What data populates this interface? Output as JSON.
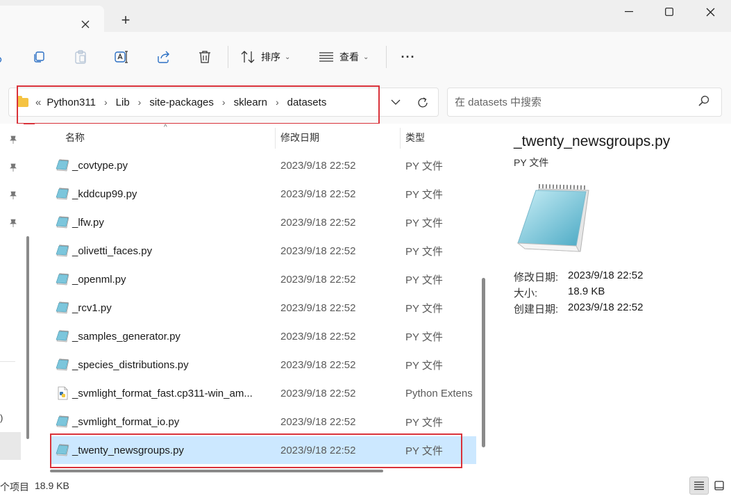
{
  "window": {
    "new_tab": "+"
  },
  "toolbar": {
    "sort_label": "排序",
    "view_label": "查看",
    "more_label": "···"
  },
  "address": {
    "overflow": "«",
    "crumbs": [
      "Python311",
      "Lib",
      "site-packages",
      "sklearn",
      "datasets"
    ],
    "separator": "›"
  },
  "search": {
    "placeholder": "在 datasets 中搜索"
  },
  "columns": {
    "name": "名称",
    "modified": "修改日期",
    "type": "类型"
  },
  "files": [
    {
      "name": "_covtype.py",
      "date": "2023/9/18 22:52",
      "type": "PY 文件",
      "icon": "notepad-icon"
    },
    {
      "name": "_kddcup99.py",
      "date": "2023/9/18 22:52",
      "type": "PY 文件",
      "icon": "notepad-icon"
    },
    {
      "name": "_lfw.py",
      "date": "2023/9/18 22:52",
      "type": "PY 文件",
      "icon": "notepad-icon"
    },
    {
      "name": "_olivetti_faces.py",
      "date": "2023/9/18 22:52",
      "type": "PY 文件",
      "icon": "notepad-icon"
    },
    {
      "name": "_openml.py",
      "date": "2023/9/18 22:52",
      "type": "PY 文件",
      "icon": "notepad-icon"
    },
    {
      "name": "_rcv1.py",
      "date": "2023/9/18 22:52",
      "type": "PY 文件",
      "icon": "notepad-icon"
    },
    {
      "name": "_samples_generator.py",
      "date": "2023/9/18 22:52",
      "type": "PY 文件",
      "icon": "notepad-icon"
    },
    {
      "name": "_species_distributions.py",
      "date": "2023/9/18 22:52",
      "type": "PY 文件",
      "icon": "notepad-icon"
    },
    {
      "name": "_svmlight_format_fast.cp311-win_am...",
      "date": "2023/9/18 22:52",
      "type": "Python Extens",
      "icon": "python-extension-icon"
    },
    {
      "name": "_svmlight_format_io.py",
      "date": "2023/9/18 22:52",
      "type": "PY 文件",
      "icon": "notepad-icon"
    },
    {
      "name": "_twenty_newsgroups.py",
      "date": "2023/9/18 22:52",
      "type": "PY 文件",
      "icon": "notepad-icon",
      "selected": true
    }
  ],
  "details": {
    "title": "_twenty_newsgroups.py",
    "subtitle": "PY 文件",
    "modified_label": "修改日期:",
    "modified_value": "2023/9/18 22:52",
    "size_label": "大小:",
    "size_value": "18.9 KB",
    "created_label": "创建日期:",
    "created_value": "2023/9/18 22:52"
  },
  "nav": {
    "paren": ")"
  },
  "status": {
    "selection": "个项目",
    "size": "18.9 KB"
  },
  "colors": {
    "selection": "#cce8ff",
    "highlight_box": "#d9323a",
    "folder": "#f5c342"
  }
}
